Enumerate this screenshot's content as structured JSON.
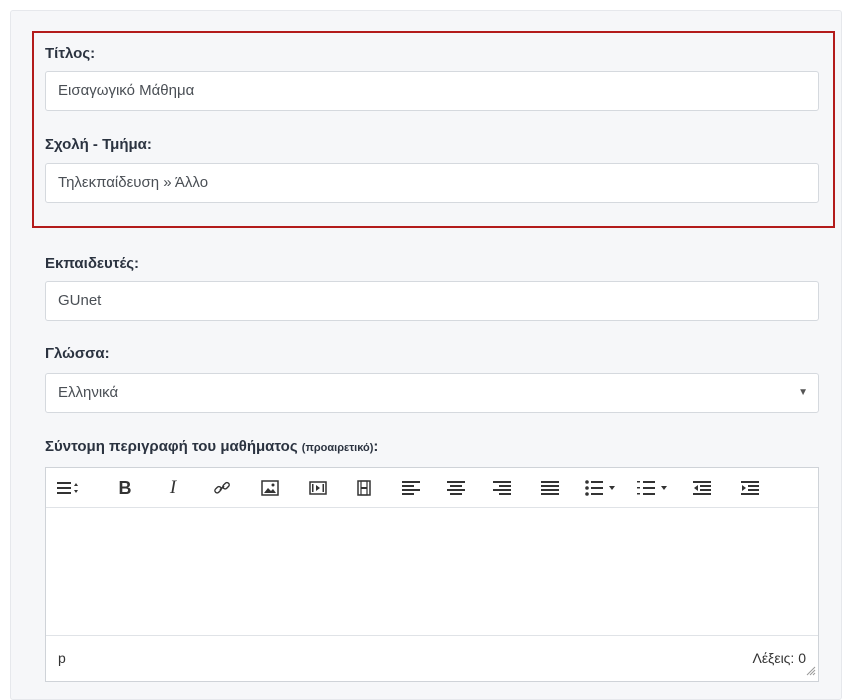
{
  "form": {
    "title": {
      "label": "Τίτλος:",
      "value": "Εισαγωγικό Μάθημα"
    },
    "department": {
      "label": "Σχολή - Τμήμα:",
      "value": "Τηλεκπαίδευση » Άλλο"
    },
    "instructors": {
      "label": "Εκπαιδευτές:",
      "value": "GUnet"
    },
    "language": {
      "label": "Γλώσσα:",
      "selected": "Ελληνικά"
    },
    "description": {
      "label": "Σύντομη περιγραφή του μαθήματος",
      "optional": "(προαιρετικό)",
      "colon": ":"
    }
  },
  "editor": {
    "toolbar": [
      "paragraph-format-icon",
      "bold-icon",
      "italic-icon",
      "link-icon",
      "image-icon",
      "media-icon",
      "video-icon",
      "align-left-icon",
      "align-center-icon",
      "align-right-icon",
      "align-justify-icon",
      "bullet-list-icon",
      "numbered-list-icon",
      "outdent-icon",
      "indent-icon"
    ],
    "bold_glyph": "B",
    "italic_glyph": "I",
    "status_path": "p",
    "word_count_label": "Λέξεις: 0"
  },
  "colors": {
    "highlight_border": "#b31b1b",
    "label_text": "#2b3340"
  }
}
